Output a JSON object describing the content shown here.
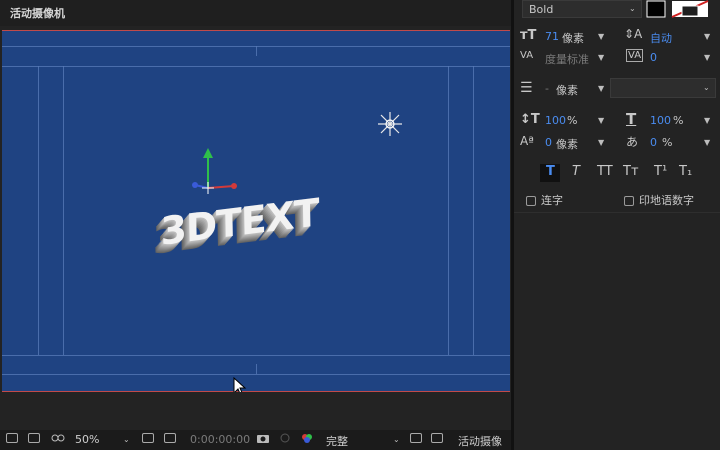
{
  "viewer": {
    "title": "活动摄像机",
    "text_layer": "3DTEXT",
    "toolbar": {
      "zoom": "50%",
      "timecode": "0:00:00:00",
      "resolution": "完整",
      "camera": "活动摄像"
    }
  },
  "panel": {
    "font_style": "Bold",
    "font_size": {
      "value": "71",
      "unit": "像素"
    },
    "leading": "自动",
    "kerning": "度量标准",
    "tracking": "0",
    "stroke_width": {
      "value": "-",
      "unit": "像素"
    },
    "vertical_scale": {
      "value": "100",
      "unit": "%"
    },
    "horizontal_scale": {
      "value": "100",
      "unit": "%"
    },
    "baseline_shift": {
      "value": "0",
      "unit": "像素"
    },
    "tsume": {
      "value": "0",
      "unit": "%"
    },
    "style_buttons": [
      "T",
      "T",
      "TT",
      "Tт",
      "T¹",
      "T₁"
    ],
    "ligatures_label": "连字",
    "hindi_digits_label": "印地语数字"
  },
  "colors": {
    "comp_background": "#1f4382",
    "panel_background": "#232323",
    "accent_blue": "#4a8cf0"
  }
}
